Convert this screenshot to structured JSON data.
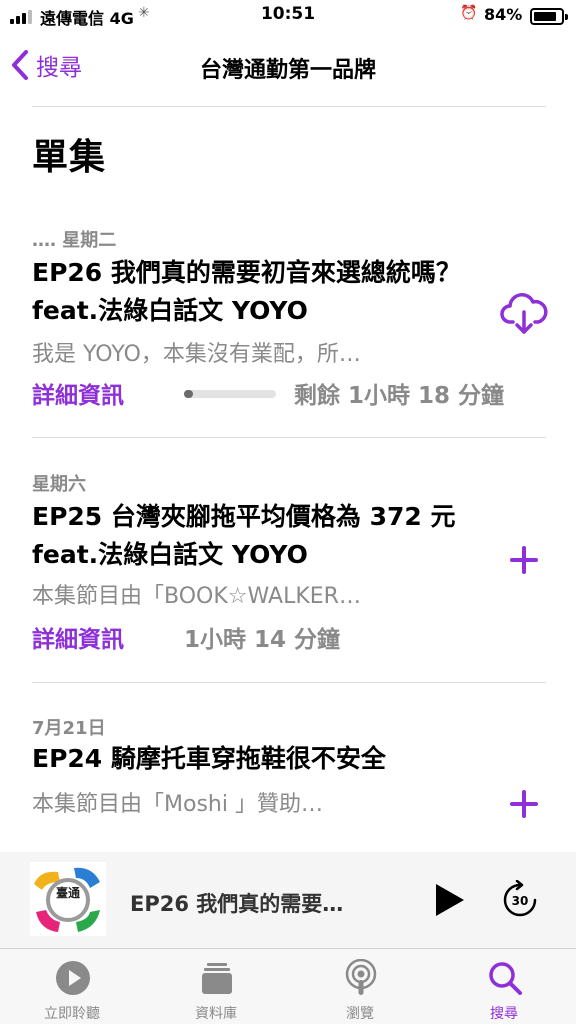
{
  "status_bar": {
    "carrier": "遠傳電信",
    "network": "4G",
    "time": "10:51",
    "battery_percent": "84%",
    "battery_level": 0.84
  },
  "nav": {
    "back_label": "搜尋",
    "title": "台灣通勤第一品牌"
  },
  "section_title": "單集",
  "episodes": [
    {
      "date": "‥‥ 星期二",
      "title": "EP26 我們真的需要初音來選總統嗎？feat.法綠白話文 YOYO",
      "description": "我是 YOYO，本集沒有業配，所…",
      "details_label": "詳細資訊",
      "duration": "剩餘 1小時 18 分鐘",
      "progress": 0.1,
      "action": "download-icon"
    },
    {
      "date": "星期六",
      "title": "EP25 台灣夾腳拖平均價格為 372 元 feat.法綠白話文 YOYO",
      "description": "本集節目由「BOOK☆WALKER…",
      "details_label": "詳細資訊",
      "duration": "1小時 14 分鐘",
      "action": "plus-icon"
    },
    {
      "date": "7月21日",
      "title": "EP24 騎摩托車穿拖鞋很不安全",
      "description": "本集節目由「Moshi 」贊助…",
      "action": "plus-icon"
    }
  ],
  "mini_player": {
    "artwork_text": "臺通",
    "now_playing": "EP26 我們真的需要…",
    "skip_seconds": "30"
  },
  "tabs": [
    {
      "label": "立即聆聽",
      "icon": "play-circle-icon"
    },
    {
      "label": "資料庫",
      "icon": "library-icon"
    },
    {
      "label": "瀏覽",
      "icon": "podcast-icon"
    },
    {
      "label": "搜尋",
      "icon": "search-icon",
      "active": true
    }
  ],
  "colors": {
    "accent": "#8e2fd8",
    "secondary_text": "#8a8a8a"
  }
}
